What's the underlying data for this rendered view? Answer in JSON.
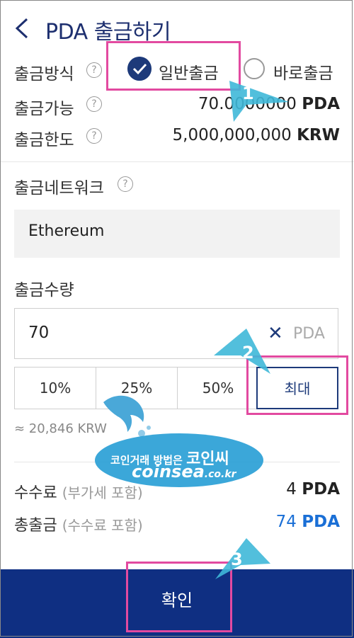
{
  "header": {
    "title": "PDA 출금하기"
  },
  "method": {
    "label": "출금방식",
    "help": "?",
    "option_normal": "일반출금",
    "option_instant": "바로출금"
  },
  "available": {
    "label": "출금가능",
    "help": "?",
    "amount": "70.0000000",
    "unit": "PDA"
  },
  "limit": {
    "label": "출금한도",
    "help": "?",
    "amount": "5,000,000,000",
    "unit": "KRW"
  },
  "network": {
    "label": "출금네트워크",
    "help": "?",
    "value": "Ethereum"
  },
  "quantity": {
    "label": "출금수량",
    "value": "70",
    "clear": "✕",
    "unit": "PDA",
    "percent_buttons": [
      "10%",
      "25%",
      "50%",
      "최대"
    ],
    "approx": "≈ 20,846 KRW"
  },
  "fee": {
    "label": "수수료",
    "note": "(부가세 포함)",
    "amount": "4",
    "unit": "PDA"
  },
  "total": {
    "label": "총출금",
    "note": "(수수료 포함)",
    "amount": "74",
    "unit": "PDA",
    "color": "#1a6fd6"
  },
  "confirm_button": {
    "label": "확인"
  },
  "annotations": {
    "step1": "1",
    "step2": "2",
    "step3": "3",
    "highlight_color": "#e24aa0",
    "arrow_color": "#3fb8d8"
  },
  "watermark": {
    "line1": "코인거래 방법은",
    "line1b": "코인씨",
    "line2": "coinsea",
    "line2b": ".co.kr"
  }
}
